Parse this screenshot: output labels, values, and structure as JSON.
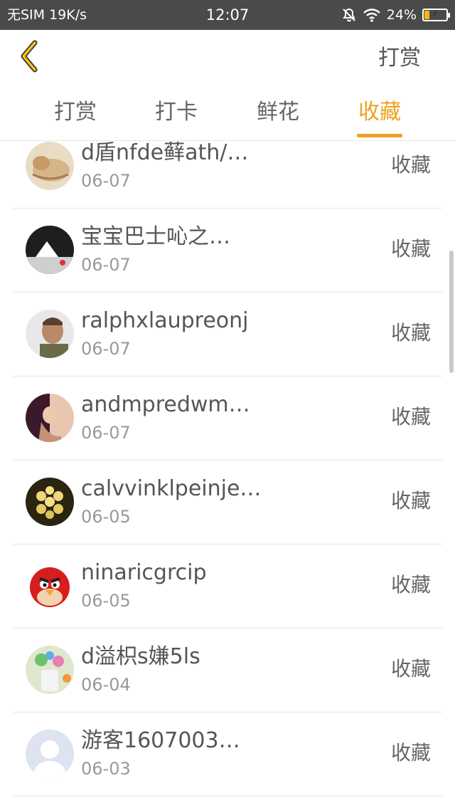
{
  "status_bar": {
    "carrier": "无SIM",
    "speed": "19K/s",
    "time": "12:07",
    "battery": "24%",
    "battery_level": 0.24,
    "icons": [
      "bell-muted-icon",
      "wifi-icon",
      "battery-charging-icon"
    ]
  },
  "header": {
    "back_icon": "chevron-left-icon",
    "action_label": "打赏",
    "accent_color": "#f0a020"
  },
  "tabs": [
    {
      "label": "打赏"
    },
    {
      "label": "打卡"
    },
    {
      "label": "鲜花"
    },
    {
      "label": "收藏",
      "active": true
    }
  ],
  "list": {
    "items": [
      {
        "name": "d盾nfde藓ath/…",
        "date": "06-07",
        "action": "收藏",
        "avatar": "cat-photo"
      },
      {
        "name": "宝宝巴士吣之…",
        "date": "06-07",
        "action": "收藏",
        "avatar": "dark-photo"
      },
      {
        "name": "ralphxlaupreonj",
        "date": "06-07",
        "action": "收藏",
        "avatar": "man-photo"
      },
      {
        "name": "andmpredwm…",
        "date": "06-07",
        "action": "收藏",
        "avatar": "woman-photo"
      },
      {
        "name": "calvvinklpeinje…",
        "date": "06-05",
        "action": "收藏",
        "avatar": "succulent-photo"
      },
      {
        "name": "ninaricgrcip",
        "date": "06-05",
        "action": "收藏",
        "avatar": "red-bird-cartoon"
      },
      {
        "name": "d溢枳s嫌5ls",
        "date": "06-04",
        "action": "收藏",
        "avatar": "toys-photo"
      },
      {
        "name": "游客1607003…",
        "date": "06-03",
        "action": "收藏",
        "avatar": "default-user-icon"
      }
    ]
  }
}
